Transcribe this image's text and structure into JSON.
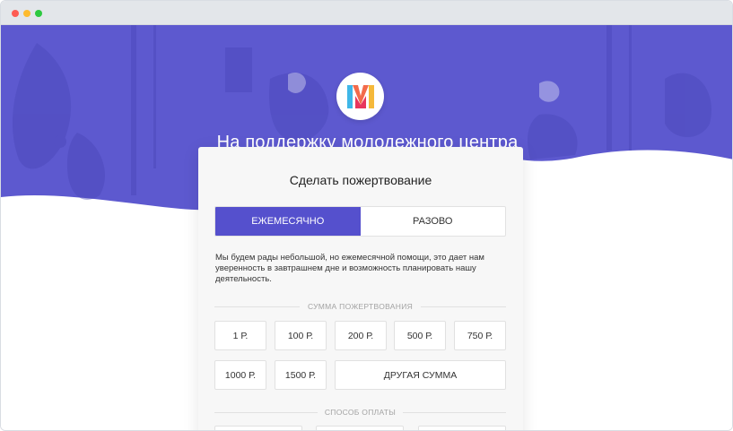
{
  "window": {
    "colors": {
      "hero_purple": "#5d59cf",
      "accent": "#5550cd"
    }
  },
  "hero": {
    "logo_letter": "M",
    "title": "На поддержку молодежного центра"
  },
  "form": {
    "title": "Сделать пожертвование",
    "frequency": {
      "options": [
        "ЕЖЕМЕСЯЧНО",
        "РАЗОВО"
      ],
      "selected": "ЕЖЕМЕСЯЧНО"
    },
    "description": "Мы будем рады небольшой, но ежемесячной помощи, это дает нам уверенность в завтрашнем дне и возможность планировать нашу деятельность.",
    "amount_section_label": "СУММА ПОЖЕРТВОВАНИЯ",
    "amounts": [
      "1 Р.",
      "100 Р.",
      "200 Р.",
      "500 Р.",
      "750 Р.",
      "1000 Р.",
      "1500 Р."
    ],
    "other_amount_label": "ДРУГАЯ СУММА",
    "payment_section_label": "СПОСОБ ОПЛАТЫ"
  }
}
